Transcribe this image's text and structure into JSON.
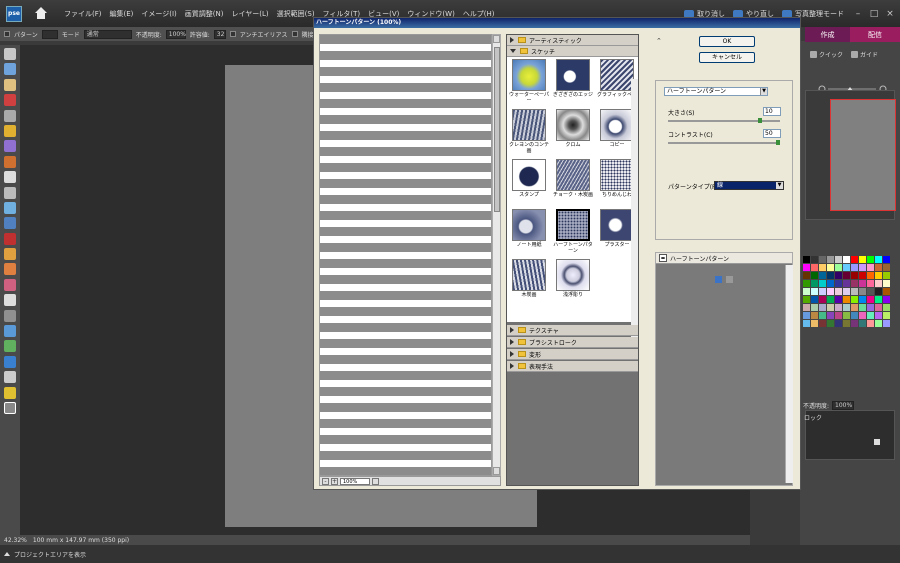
{
  "app": {
    "logo_text": "pse",
    "menus": [
      "ファイル(F)",
      "編集(E)",
      "イメージ(I)",
      "画質調整(N)",
      "レイヤー(L)",
      "選択範囲(S)",
      "フィルタ(T)",
      "ビュー(V)",
      "ウィンドウ(W)",
      "ヘルプ(H)"
    ],
    "undo_label": "取り消し",
    "redo_label": "やり直し",
    "organizer_label": "写真整理モード"
  },
  "options_bar": {
    "pattern_label": "パターン",
    "mode_label": "モード",
    "mode_value": "通常",
    "opacity_label": "不透明度:",
    "opacity_value": "100%",
    "tolerance_label": "許容値:",
    "tolerance_value": "32",
    "antialias_label": "アンチエイリアス",
    "adjacent_label": "隣接"
  },
  "right_panel": {
    "tab_create": "作成",
    "tab_share": "配信",
    "subtab_quick": "クイック",
    "subtab_guide": "ガイド",
    "opacity_label": "不透明度:",
    "opacity_value": "100%",
    "lock_label": "ロック"
  },
  "status": {
    "zoom": "42.32%",
    "doc_info": "100 mm x 147.97 mm (350 ppi)",
    "project_bin": "プロジェクトエリアを表示"
  },
  "dialog": {
    "title": "ハーフトーンパターン (100%)",
    "preview_zoom": "100%",
    "ok_label": "OK",
    "cancel_label": "キャンセル",
    "filter_name": "ハーフトーンパターン",
    "size_label": "大きさ(S)",
    "size_value": "10",
    "contrast_label": "コントラスト(C)",
    "contrast_value": "50",
    "pattern_type_label": "パターンタイプ(P):",
    "pattern_type_value": "線",
    "effect_layer_label": "ハーフトーンパターン",
    "folders": {
      "artistic": "アーティスティック",
      "sketch": "スケッチ",
      "texture": "テクスチャ",
      "brush": "ブラシストローク",
      "distort": "変形",
      "stylize": "表現手法"
    },
    "thumbnails": [
      {
        "label": "ウォーターペーパー"
      },
      {
        "label": "ぎざぎざのエッジ"
      },
      {
        "label": "グラフィックペン"
      },
      {
        "label": "クレヨンのコンテ画"
      },
      {
        "label": "クロム"
      },
      {
        "label": "コピー"
      },
      {
        "label": "スタンプ"
      },
      {
        "label": "チョーク・木炭画"
      },
      {
        "label": "ちりめんじわ"
      },
      {
        "label": "ノート用紙"
      },
      {
        "label": "ハーフトーンパターン"
      },
      {
        "label": "プラスター"
      },
      {
        "label": "木炭画"
      },
      {
        "label": "浅浮彫り"
      }
    ]
  }
}
